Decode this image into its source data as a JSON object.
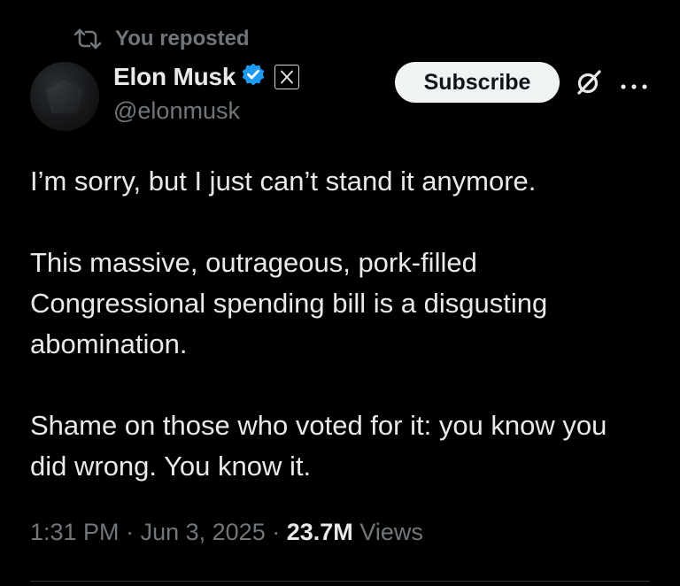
{
  "repost": {
    "label": "You reposted",
    "icon": "repost-icon"
  },
  "author": {
    "name": "Elon Musk",
    "handle": "@elonmusk",
    "verified_icon": "verified-badge-icon",
    "affiliate_icon": "x-logo-icon",
    "verified_color": "#1d9bf0"
  },
  "actions": {
    "subscribe_label": "Subscribe",
    "grok_icon": "grok-icon",
    "more_icon": "more-options-icon"
  },
  "tweet": {
    "paragraphs": [
      "I’m sorry, but I just can’t stand it anymore.",
      "This massive, outrageous, pork-filled Congressional spending bill is a disgusting abomination.",
      "Shame on those who voted for it: you know you did wrong. You know it."
    ]
  },
  "meta": {
    "time": "1:31 PM",
    "separator": "·",
    "date": "Jun 3, 2025",
    "views_count": "23.7M",
    "views_label": "Views"
  },
  "colors": {
    "background": "#000000",
    "primary_text": "#e7e9ea",
    "secondary_text": "#71767b",
    "button_bg": "#eff3f4",
    "button_text": "#0f1419"
  }
}
